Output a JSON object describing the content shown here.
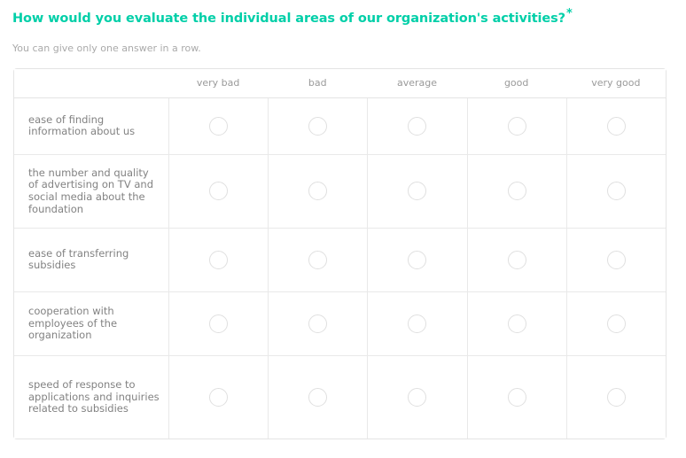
{
  "question": {
    "title": "How would you evaluate the individual areas of our organization's activities?",
    "required_marker": "*",
    "hint": "You can give only one answer in a row.",
    "accent_color": "#00cfa8"
  },
  "matrix": {
    "corner_label": "",
    "columns": [
      {
        "label": "very bad"
      },
      {
        "label": "bad"
      },
      {
        "label": "average"
      },
      {
        "label": "good"
      },
      {
        "label": "very good"
      }
    ],
    "rows": [
      {
        "label": "ease of finding information about us",
        "selected": null
      },
      {
        "label": "the number and quality of advertising on TV and social media about the foundation",
        "selected": null
      },
      {
        "label": "ease of transferring subsidies",
        "selected": null
      },
      {
        "label": "cooperation with employees of the organization",
        "selected": null
      },
      {
        "label": "speed of response to applications and inquiries related to subsidies",
        "selected": null
      }
    ]
  }
}
